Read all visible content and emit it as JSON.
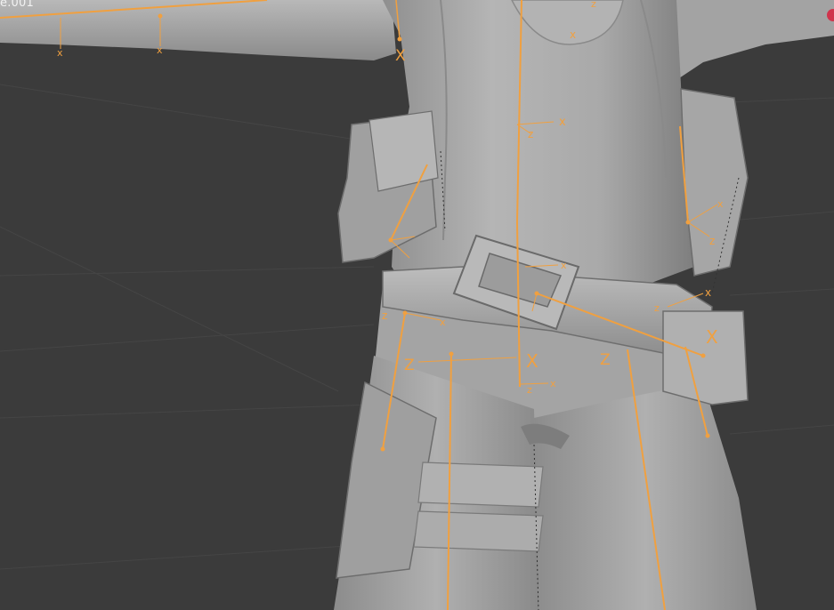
{
  "viewport": {
    "object_name": "e.001",
    "background_color": "#3b3b3b",
    "bone_color": "#f0a040",
    "mesh_color": "#a7a7a7",
    "gizmo_dot_color": "#d0344c"
  },
  "axis_labels": {
    "x": "X",
    "x_small": "x",
    "z": "Z",
    "z_small": "z"
  }
}
